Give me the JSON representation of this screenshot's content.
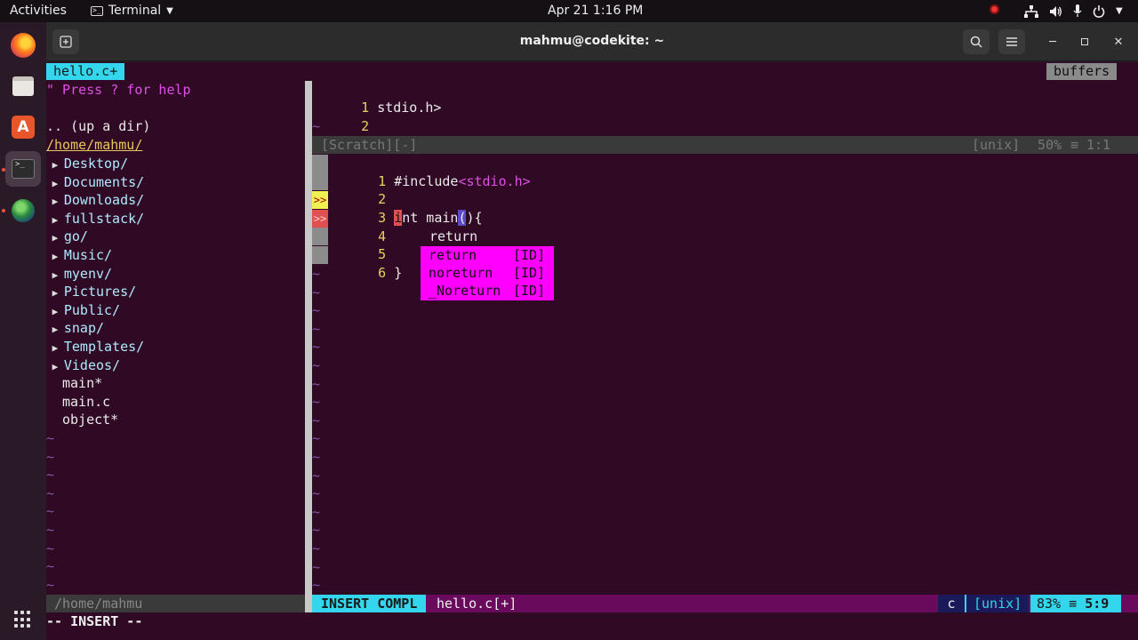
{
  "topbar": {
    "activities": "Activities",
    "app_name": "Terminal",
    "clock": "Apr 21  1:16 PM",
    "icons": [
      "recording-icon",
      "network-icon",
      "volume-icon",
      "microphone-icon",
      "power-icon"
    ]
  },
  "dock": {
    "items": [
      "firefox",
      "files",
      "software-center",
      "terminal",
      "browser"
    ]
  },
  "window": {
    "title": "mahmu@codekite: ~"
  },
  "vim": {
    "tab_label": "hello.c+",
    "buffers_label": "buffers",
    "nerdtree": {
      "help": "\" Press ? for help",
      "up_dir": ".. (up a dir)",
      "root": "/home/mahmu/",
      "dirs": [
        "Desktop/",
        "Documents/",
        "Downloads/",
        "fullstack/",
        "go/",
        "Music/",
        "myenv/",
        "Pictures/",
        "Public/",
        "snap/",
        "Templates/",
        "Videos/"
      ],
      "files": [
        "main*",
        "main.c",
        "object*"
      ],
      "status": "/home/mahmu"
    },
    "scratch": {
      "lines": [
        {
          "num": "1",
          "text": "stdio.h>"
        },
        {
          "num": "2",
          "text": ""
        }
      ],
      "status": {
        "name": "[Scratch][-]",
        "format": "[unix]",
        "percent": "50%",
        "sep": "≡",
        "pos": "1:1"
      }
    },
    "editor": {
      "line1": {
        "num": "1",
        "directive": "#include",
        "header": "<stdio.h>"
      },
      "line2": {
        "num": "2"
      },
      "line3": {
        "num": "3",
        "err_char": "i",
        "rest": "nt main",
        "paren_open": "(",
        "tail": "){"
      },
      "line4": {
        "num": "4"
      },
      "line5": {
        "num": "5",
        "typed": "return"
      },
      "line6": {
        "num": "6",
        "text": "}"
      },
      "signs": {
        "warn": ">>",
        "error": ">>"
      }
    },
    "completion": [
      {
        "word": "return",
        "kind": "[ID]"
      },
      {
        "word": "noreturn",
        "kind": "[ID]"
      },
      {
        "word": "_Noreturn",
        "kind": "[ID]"
      }
    ],
    "statusline": {
      "mode": "INSERT COMPL",
      "file": "hello.c[+]",
      "filetype": "c",
      "format": "[unix]",
      "percent": "83%",
      "sep": "≡",
      "pos": "5:9"
    },
    "cmdline": "-- INSERT --",
    "tilde": "~"
  }
}
